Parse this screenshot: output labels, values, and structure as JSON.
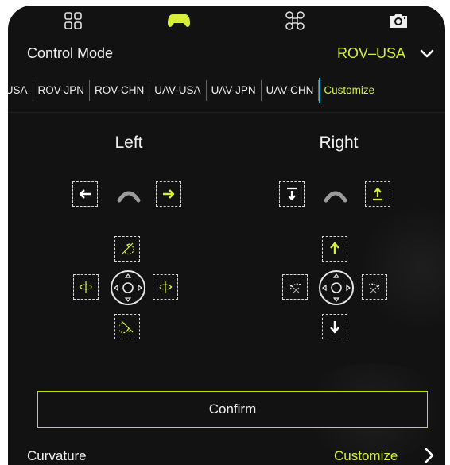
{
  "colors": {
    "accent": "#d7ee3c",
    "selection_border": "#27c6e6",
    "background": "#121212",
    "text": "#f0f0f0"
  },
  "top_tabs": [
    {
      "name": "grid-icon",
      "active": false
    },
    {
      "name": "gamepad-icon",
      "active": true
    },
    {
      "name": "drone-icon",
      "active": false
    },
    {
      "name": "camera-icon",
      "active": false
    }
  ],
  "control_mode": {
    "label": "Control Mode",
    "value": "ROV–USA",
    "icon": "chevron-down-icon"
  },
  "mode_tabs": [
    {
      "label": "V-USA",
      "active": false
    },
    {
      "label": "ROV-JPN",
      "active": false
    },
    {
      "label": "ROV-CHN",
      "active": false
    },
    {
      "label": "UAV-USA",
      "active": false
    },
    {
      "label": "UAV-JPN",
      "active": false
    },
    {
      "label": "UAV-CHN",
      "active": false
    },
    {
      "label": "Customize",
      "active": true
    }
  ],
  "left": {
    "title": "Left",
    "icons": [
      "arrow-left-icon",
      "arc-icon",
      "arrow-right-icon",
      "rotate-ccw-icon",
      "rotate-left-icon",
      "joystick-icon",
      "rotate-right-icon",
      "rotate-cw-icon"
    ]
  },
  "right": {
    "title": "Right",
    "icons": [
      "descend-icon",
      "arc-icon",
      "ascend-icon",
      "arrow-up-icon",
      "yaw-left-icon",
      "joystick-icon",
      "yaw-right-icon",
      "arrow-down-icon"
    ]
  },
  "confirm": {
    "label": "Confirm"
  },
  "curvature": {
    "label": "Curvature",
    "value": "Customize",
    "icon": "chevron-right-icon"
  }
}
